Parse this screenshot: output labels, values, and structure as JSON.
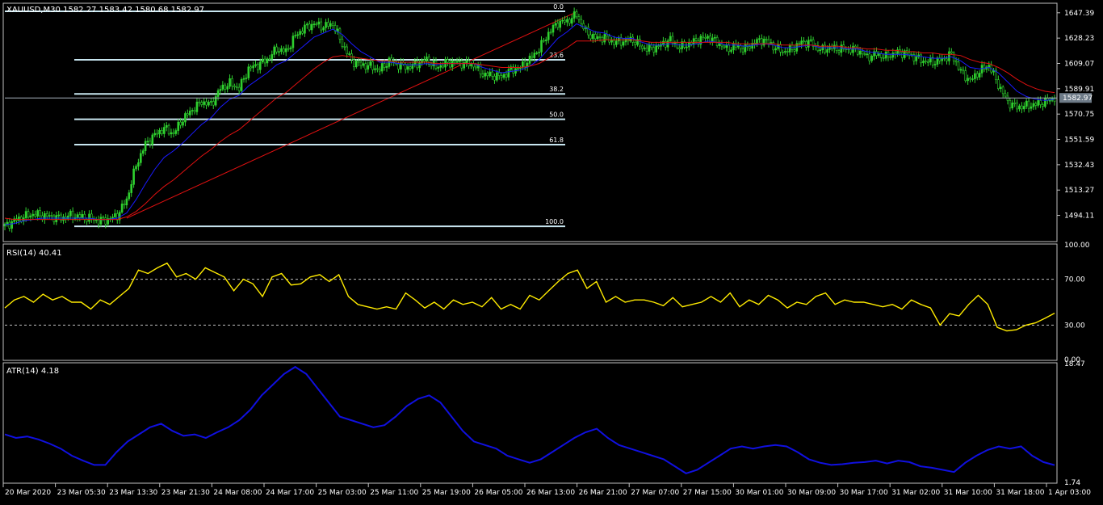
{
  "colors": {
    "background": "#000000",
    "frame": "#c0c0c0",
    "text": "#ffffff",
    "candle": "#2fd12f",
    "ma_fast": "#1a1aff",
    "ma_slow": "#e01010",
    "trendline": "#e01010",
    "fib": "#c8e6f0",
    "price_line": "#a9b2bd",
    "price_box": "#6d7a87",
    "rsi": "#ffeb00",
    "atr": "#1010e0",
    "grid_dashed": "#bdbdbd"
  },
  "chart_data": [
    {
      "type": "line",
      "panel": "price",
      "title": "XAUUSD,M30  1582.27 1583.42 1580.68 1582.97",
      "symbol": "XAUUSD,M30",
      "ohlc": {
        "open": "1582.27",
        "high": "1583.42",
        "low": "1580.68",
        "close": "1582.97"
      },
      "current_price": "1582.97",
      "ylim": [
        1475.5,
        1654
      ],
      "y_ticks": [
        "1647.39",
        "1628.23",
        "1609.07",
        "1589.91",
        "1570.75",
        "1551.59",
        "1532.43",
        "1513.27",
        "1494.11"
      ],
      "x_tick_labels": [
        "20 Mar 2020",
        "23 Mar 05:30",
        "23 Mar 13:30",
        "23 Mar 21:30",
        "24 Mar 08:00",
        "24 Mar 17:00",
        "25 Mar 03:00",
        "25 Mar 11:00",
        "25 Mar 19:00",
        "26 Mar 05:00",
        "26 Mar 13:00",
        "26 Mar 21:00",
        "27 Mar 07:00",
        "27 Mar 15:00",
        "30 Mar 01:00",
        "30 Mar 09:00",
        "30 Mar 17:00",
        "31 Mar 02:00",
        "31 Mar 10:00",
        "31 Mar 18:00",
        "1 Apr 03:00"
      ],
      "series": [
        {
          "kind": "close",
          "values": [
            1486,
            1490,
            1493,
            1495,
            1494,
            1493,
            1492,
            1494,
            1493,
            1492,
            1490,
            1491,
            1494,
            1506,
            1532,
            1548,
            1555,
            1560,
            1556,
            1567,
            1574,
            1580,
            1578,
            1590,
            1594,
            1590,
            1605,
            1608,
            1612,
            1620,
            1618,
            1630,
            1636,
            1639,
            1637,
            1639,
            1624,
            1611,
            1608,
            1607,
            1604,
            1611,
            1608,
            1606,
            1609,
            1612,
            1606,
            1609,
            1610,
            1609,
            1608,
            1601,
            1600,
            1599,
            1604,
            1606,
            1612,
            1620,
            1632,
            1640,
            1641,
            1646,
            1633,
            1628,
            1629,
            1625,
            1626,
            1627,
            1621,
            1620,
            1623,
            1627,
            1621,
            1624,
            1627,
            1629,
            1625,
            1620,
            1622,
            1620,
            1625,
            1627,
            1622,
            1618,
            1620,
            1625,
            1625,
            1619,
            1621,
            1620,
            1620,
            1619,
            1614,
            1616,
            1614,
            1617,
            1617,
            1614,
            1611,
            1610,
            1612,
            1616,
            1603,
            1596,
            1603,
            1608,
            1593,
            1580,
            1576,
            1577,
            1578,
            1580,
            1582.97
          ]
        },
        {
          "kind": "ma_fast",
          "values": [
            1487,
            1488,
            1490,
            1491,
            1492,
            1492,
            1492,
            1492,
            1492,
            1492,
            1491,
            1491,
            1492,
            1496,
            1506,
            1518,
            1529,
            1538,
            1543,
            1549,
            1556,
            1563,
            1568,
            1576,
            1582,
            1585,
            1592,
            1597,
            1602,
            1608,
            1611,
            1617,
            1623,
            1629,
            1632,
            1635,
            1631,
            1624,
            1618,
            1614,
            1610,
            1610,
            1609,
            1608,
            1608,
            1609,
            1608,
            1609,
            1609,
            1609,
            1609,
            1606,
            1604,
            1602,
            1603,
            1604,
            1607,
            1612,
            1620,
            1628,
            1633,
            1639,
            1636,
            1633,
            1632,
            1629,
            1628,
            1628,
            1625,
            1623,
            1623,
            1624,
            1623,
            1623,
            1624,
            1626,
            1625,
            1623,
            1623,
            1622,
            1623,
            1624,
            1623,
            1621,
            1621,
            1622,
            1623,
            1621,
            1621,
            1621,
            1620,
            1620,
            1618,
            1617,
            1616,
            1616,
            1616,
            1615,
            1614,
            1613,
            1613,
            1614,
            1611,
            1606,
            1605,
            1606,
            1602,
            1595,
            1588,
            1584,
            1582,
            1581,
            1582
          ]
        },
        {
          "kind": "ma_slow",
          "values": [
            1492,
            1491,
            1491,
            1491,
            1491,
            1491,
            1491,
            1491,
            1491,
            1491,
            1491,
            1491,
            1491,
            1493,
            1497,
            1503,
            1510,
            1516,
            1521,
            1527,
            1533,
            1539,
            1544,
            1550,
            1555,
            1559,
            1565,
            1571,
            1577,
            1583,
            1587,
            1593,
            1599,
            1605,
            1610,
            1614,
            1615,
            1614,
            1613,
            1612,
            1611,
            1611,
            1610,
            1610,
            1610,
            1610,
            1609,
            1609,
            1609,
            1609,
            1609,
            1608,
            1607,
            1606,
            1606,
            1606,
            1607,
            1609,
            1613,
            1617,
            1621,
            1626,
            1626,
            1626,
            1627,
            1627,
            1627,
            1627,
            1626,
            1625,
            1625,
            1625,
            1625,
            1625,
            1625,
            1625,
            1625,
            1625,
            1624,
            1624,
            1624,
            1624,
            1624,
            1623,
            1623,
            1623,
            1623,
            1622,
            1622,
            1622,
            1621,
            1621,
            1620,
            1620,
            1619,
            1619,
            1618,
            1618,
            1617,
            1617,
            1616,
            1616,
            1615,
            1612,
            1610,
            1609,
            1606,
            1602,
            1597,
            1593,
            1590,
            1588,
            1587
          ]
        }
      ],
      "fibonacci": {
        "levels": [
          {
            "label": "0.0",
            "value": 1648.5
          },
          {
            "label": "23.6",
            "value": 1611.8
          },
          {
            "label": "38.2",
            "value": 1586.0
          },
          {
            "label": "50.0",
            "value": 1566.8
          },
          {
            "label": "61.8",
            "value": 1547.6
          },
          {
            "label": "100.0",
            "value": 1485.8
          }
        ]
      },
      "trendline": {
        "from_index": 13,
        "from_value": 1492,
        "to_index": 61,
        "to_value": 1648
      }
    },
    {
      "type": "line",
      "panel": "rsi",
      "title": "RSI(14) 40.41",
      "ylim": [
        0,
        100
      ],
      "y_ticks": [
        "100.00",
        "70.00",
        "30.00",
        "0.00"
      ],
      "levels": [
        70,
        30
      ],
      "values": [
        45,
        52,
        55,
        50,
        57,
        52,
        55,
        50,
        50,
        44,
        52,
        48,
        55,
        62,
        78,
        75,
        80,
        84,
        72,
        75,
        70,
        80,
        76,
        72,
        60,
        70,
        66,
        55,
        72,
        75,
        65,
        66,
        72,
        74,
        68,
        74,
        55,
        48,
        46,
        44,
        46,
        44,
        58,
        52,
        45,
        50,
        44,
        52,
        48,
        50,
        46,
        54,
        44,
        48,
        44,
        56,
        52,
        60,
        68,
        75,
        78,
        62,
        68,
        50,
        55,
        50,
        52,
        52,
        50,
        47,
        54,
        46,
        48,
        50,
        55,
        50,
        58,
        46,
        52,
        48,
        56,
        52,
        45,
        50,
        48,
        55,
        58,
        48,
        52,
        50,
        50,
        48,
        46,
        48,
        44,
        52,
        48,
        45,
        30,
        40,
        38,
        48,
        56,
        48,
        28,
        25,
        26,
        30,
        32,
        36,
        40.41
      ]
    },
    {
      "type": "line",
      "panel": "atr",
      "title": "ATR(14) 4.18",
      "ylim": [
        1.74,
        18.47
      ],
      "y_ticks": [
        "18.47",
        "1.74"
      ],
      "values": [
        8.5,
        8.0,
        8.2,
        7.8,
        7.2,
        6.5,
        5.5,
        4.8,
        4.2,
        4.2,
        6.0,
        7.5,
        8.5,
        9.5,
        10.0,
        9.0,
        8.3,
        8.5,
        8.0,
        8.8,
        9.5,
        10.5,
        12.0,
        14.0,
        15.5,
        17.0,
        18.0,
        17.0,
        15.0,
        13.0,
        11.0,
        10.5,
        10.0,
        9.5,
        9.8,
        11.0,
        12.5,
        13.5,
        14.0,
        13.0,
        11.0,
        9.0,
        7.5,
        7.0,
        6.5,
        5.5,
        5.0,
        4.5,
        5.0,
        6.0,
        7.0,
        8.0,
        8.8,
        9.3,
        8.0,
        7.0,
        6.5,
        6.0,
        5.5,
        5.0,
        4.0,
        3.0,
        3.5,
        4.5,
        5.5,
        6.5,
        6.8,
        6.5,
        6.8,
        7.0,
        6.8,
        6.0,
        5.0,
        4.5,
        4.2,
        4.3,
        4.5,
        4.6,
        4.8,
        4.4,
        4.8,
        4.6,
        4.0,
        3.8,
        3.5,
        3.2,
        4.5,
        5.5,
        6.3,
        6.8,
        6.5,
        6.8,
        5.5,
        4.6,
        4.18
      ]
    }
  ]
}
